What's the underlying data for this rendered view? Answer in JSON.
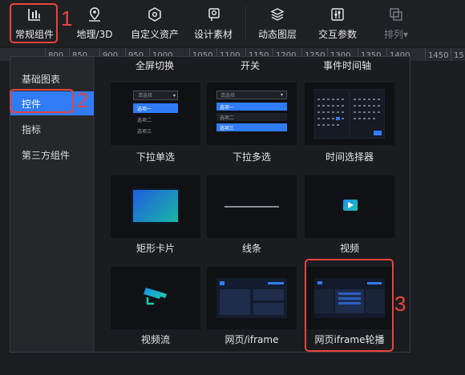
{
  "toolbar": {
    "items": [
      {
        "label": "常规组件",
        "icon": "bar-chart-icon"
      },
      {
        "label": "地理/3D",
        "icon": "map-pin-icon"
      },
      {
        "label": "自定义资产",
        "icon": "hexagon-icon"
      },
      {
        "label": "设计素材",
        "icon": "design-asset-icon"
      },
      {
        "label": "动态图层",
        "icon": "layers-icon"
      },
      {
        "label": "交互参数",
        "icon": "sliders-icon"
      },
      {
        "label": "排列▾",
        "icon": "arrange-icon"
      }
    ]
  },
  "annotations": [
    "1",
    "2",
    "3"
  ],
  "ruler": {
    "ticks": [
      "800",
      "850",
      "900",
      "950",
      "1000",
      "1050",
      "1100",
      "1150",
      "1200",
      "1250",
      "1300",
      "1350",
      "1400",
      "1450",
      "15"
    ]
  },
  "sidebar": {
    "items": [
      {
        "label": "基础图表"
      },
      {
        "label": "控件"
      },
      {
        "label": "指标"
      },
      {
        "label": "第三方组件"
      }
    ]
  },
  "content": {
    "column_titles": [
      "全屏切换",
      "开关",
      "事件时间轴"
    ],
    "cards": [
      {
        "label": "下拉单选"
      },
      {
        "label": "下拉多选"
      },
      {
        "label": "时间选择器"
      },
      {
        "label": "矩形卡片"
      },
      {
        "label": "线条"
      },
      {
        "label": "视频"
      },
      {
        "label": "视频流"
      },
      {
        "label": "网页/iframe"
      },
      {
        "label": "网页iframe轮播"
      }
    ]
  },
  "thumbs": {
    "select_placeholder": "请选择",
    "options": [
      "选项一",
      "选项二",
      "选项三"
    ]
  },
  "colors": {
    "accent": "#2f7cf6",
    "annotation": "#e8453c"
  }
}
